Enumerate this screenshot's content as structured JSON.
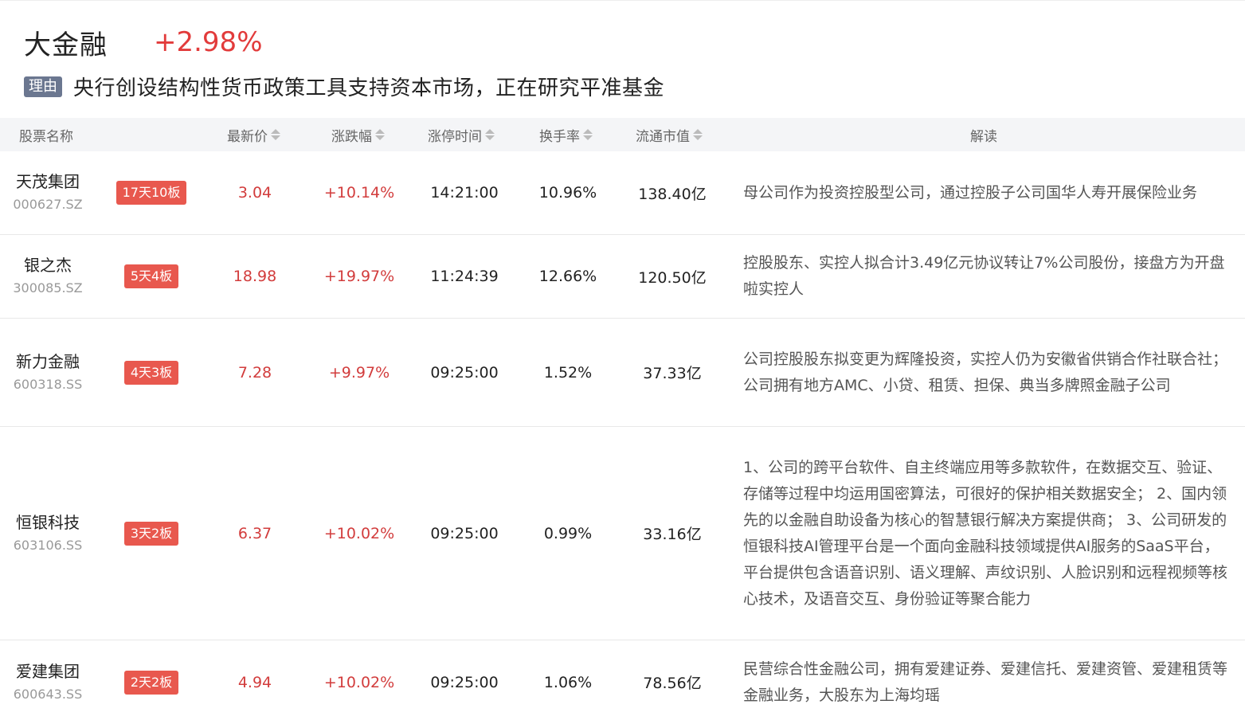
{
  "theme": {
    "title": "大金融",
    "change": "+2.98%",
    "reason_tag": "理由",
    "reason_text": "央行创设结构性货币政策工具支持资本市场，正在研究平准基金"
  },
  "columns": {
    "name": "股票名称",
    "price": "最新价",
    "change": "涨跌幅",
    "limit_time": "涨停时间",
    "turnover": "换手率",
    "market_cap": "流通市值",
    "desc": "解读"
  },
  "colors": {
    "up": "#d23c3c",
    "badge": "#e8584e",
    "reason_tag": "#6b7790",
    "header_bg": "#f4f5f7"
  },
  "rows": [
    {
      "name": "天茂集团",
      "code": "000627.SZ",
      "badge": "17天10板",
      "price": "3.04",
      "change": "+10.14%",
      "limit_time": "14:21:00",
      "turnover": "10.96%",
      "market_cap": "138.40亿",
      "desc": "母公司作为投资控股型公司，通过控股子公司国华人寿开展保险业务"
    },
    {
      "name": "银之杰",
      "code": "300085.SZ",
      "badge": "5天4板",
      "price": "18.98",
      "change": "+19.97%",
      "limit_time": "11:24:39",
      "turnover": "12.66%",
      "market_cap": "120.50亿",
      "desc": "控股股东、实控人拟合计3.49亿元协议转让7%公司股份，接盘方为开盘啦实控人"
    },
    {
      "name": "新力金融",
      "code": "600318.SS",
      "badge": "4天3板",
      "price": "7.28",
      "change": "+9.97%",
      "limit_time": "09:25:00",
      "turnover": "1.52%",
      "market_cap": "37.33亿",
      "desc": "公司控股股东拟变更为辉隆投资，实控人仍为安徽省供销合作社联合社；公司拥有地方AMC、小贷、租赁、担保、典当多牌照金融子公司"
    },
    {
      "name": "恒银科技",
      "code": "603106.SS",
      "badge": "3天2板",
      "price": "6.37",
      "change": "+10.02%",
      "limit_time": "09:25:00",
      "turnover": "0.99%",
      "market_cap": "33.16亿",
      "desc": "1、公司的跨平台软件、自主终端应用等多款软件，在数据交互、验证、存储等过程中均运用国密算法，可很好的保护相关数据安全； 2、国内领先的以金融自助设备为核心的智慧银行解决方案提供商； 3、公司研发的恒银科技AI管理平台是一个面向金融科技领域提供AI服务的SaaS平台，平台提供包含语音识别、语义理解、声纹识别、人脸识别和远程视频等核心技术，及语音交互、身份验证等聚合能力"
    },
    {
      "name": "爱建集团",
      "code": "600643.SS",
      "badge": "2天2板",
      "price": "4.94",
      "change": "+10.02%",
      "limit_time": "09:25:00",
      "turnover": "1.06%",
      "market_cap": "78.56亿",
      "desc": "民营综合性金融公司，拥有爱建证券、爱建信托、爱建资管、爱建租赁等金融业务，大股东为上海均瑶"
    }
  ]
}
